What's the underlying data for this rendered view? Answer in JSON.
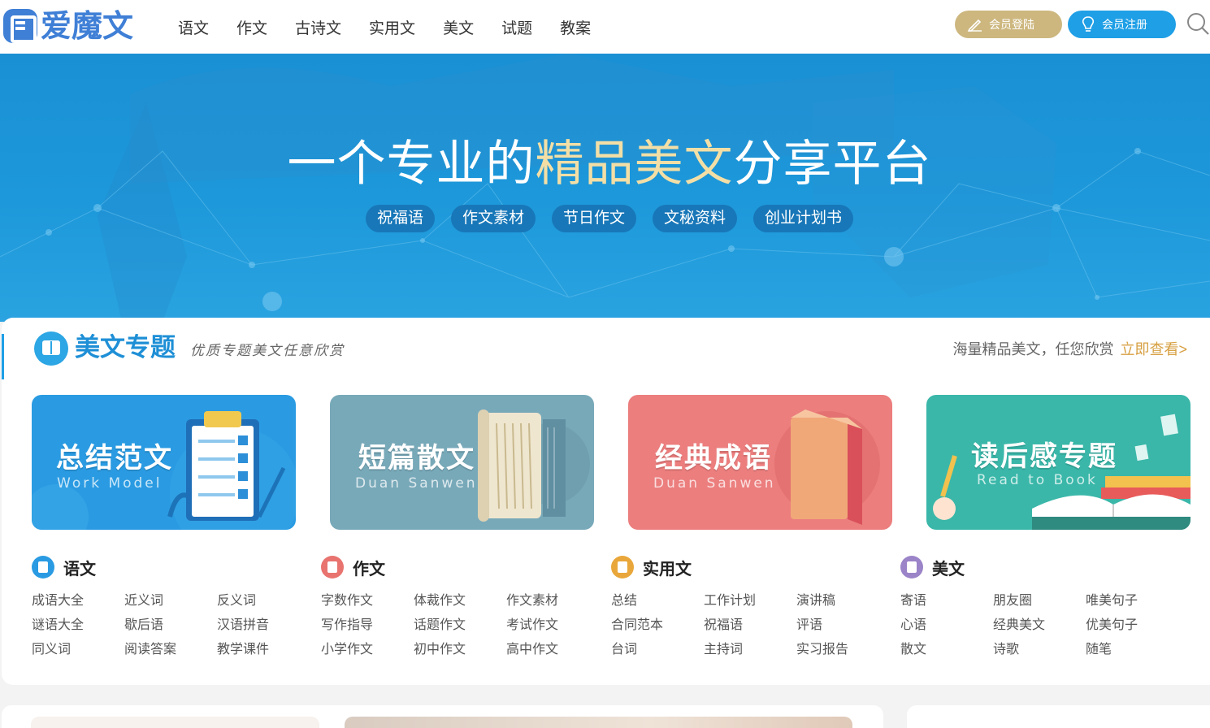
{
  "header": {
    "logo_text": "爱魔文",
    "nav": [
      "语文",
      "作文",
      "古诗文",
      "实用文",
      "美文",
      "试题",
      "教案"
    ],
    "login_label": "会员登陆",
    "register_label": "会员注册",
    "colors": {
      "brand": "#3f7fd6",
      "login": "#cdb77f",
      "register": "#1f9fe6"
    }
  },
  "banner": {
    "title_before": "一个专业的",
    "title_highlight": "精品美文",
    "title_after": "分享平台",
    "tags": [
      "祝福语",
      "作文素材",
      "节日作文",
      "文秘资料",
      "创业计划书"
    ],
    "colors": {
      "background": "#1d98da",
      "highlight": "#f3dfa6",
      "tag": "#1877b8"
    }
  },
  "section": {
    "title": "美文专题",
    "subtitle": "优质专题美文任意欣赏",
    "right_text": "海量精品美文，任您欣赏",
    "right_link": "立即查看>"
  },
  "cards": [
    {
      "title": "总结范文",
      "subtitle": "Work Model",
      "color": "#2a9be2"
    },
    {
      "title": "短篇散文",
      "subtitle": "Duan Sanwen",
      "color": "#78a9b9"
    },
    {
      "title": "经典成语",
      "subtitle": "Duan Sanwen",
      "color": "#ec7e7e"
    },
    {
      "title": "读后感专题",
      "subtitle": "Read to Book",
      "color": "#3ab7a9"
    }
  ],
  "categories": [
    {
      "title": "语文",
      "color": "#2a9be2",
      "links": [
        "成语大全",
        "近义词",
        "反义词",
        "谜语大全",
        "歇后语",
        "汉语拼音",
        "同义词",
        "阅读答案",
        "教学课件"
      ]
    },
    {
      "title": "作文",
      "color": "#e8736f",
      "links": [
        "字数作文",
        "体裁作文",
        "作文素材",
        "写作指导",
        "话题作文",
        "考试作文",
        "小学作文",
        "初中作文",
        "高中作文"
      ]
    },
    {
      "title": "实用文",
      "color": "#e9a73b",
      "links": [
        "总结",
        "工作计划",
        "演讲稿",
        "合同范本",
        "祝福语",
        "评语",
        "台词",
        "主持词",
        "实习报告"
      ]
    },
    {
      "title": "美文",
      "color": "#9b84c8",
      "links": [
        "寄语",
        "朋友圈",
        "唯美句子",
        "心语",
        "经典美文",
        "优美句子",
        "散文",
        "诗歌",
        "随笔"
      ]
    }
  ]
}
